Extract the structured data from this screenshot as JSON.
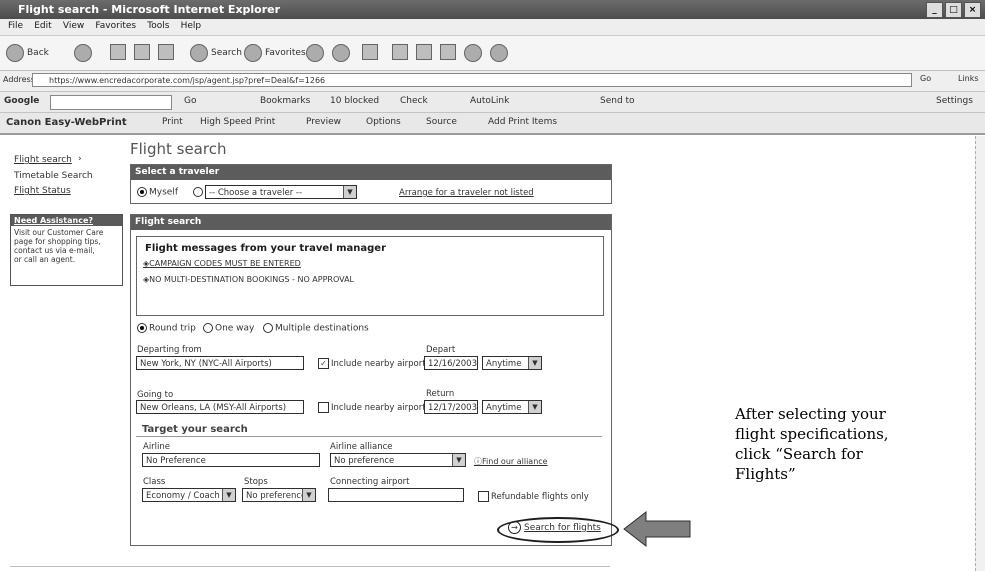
{
  "window": {
    "title": "Flight search - Microsoft Internet Explorer",
    "buttons": [
      "_",
      "□",
      "×"
    ]
  },
  "menubar": [
    "File",
    "Edit",
    "View",
    "Favorites",
    "Tools",
    "Help"
  ],
  "toolbar": {
    "back_label": "Back",
    "search_label": "Search",
    "favorites_label": "Favorites"
  },
  "address": {
    "label": "Address",
    "url": "https://www.encredacorporate.com/jsp/agent.jsp?pref=Deal&f=1266",
    "go_label": "Go",
    "links_label": "Links"
  },
  "googlebar": {
    "logo": "Google",
    "go": "Go",
    "bookmarks": "Bookmarks",
    "blocked": "10 blocked",
    "check": "Check",
    "autolink": "AutoLink",
    "sendto": "Send to",
    "settings": "Settings"
  },
  "canonbar": {
    "logo": "Canon Easy-WebPrint",
    "print": "Print",
    "high_speed": "High Speed Print",
    "preview": "Preview",
    "options": "Options",
    "source": "Source",
    "add_items": "Add Print Items"
  },
  "leftnav": {
    "flight_search": "Flight search",
    "timetable": "Timetable Search",
    "flight_status": "Flight Status",
    "help_title": "Need Assistance?",
    "help_text_1": "Visit our Customer Care",
    "help_text_2": "page for shopping tips,",
    "help_text_3": "contact us via e-mail,",
    "help_text_4": "or call an agent."
  },
  "page_title": "Flight search",
  "traveler": {
    "header": "Select a traveler",
    "myself": "Myself",
    "choose": "-- Choose a traveler --",
    "arrange": "Arrange for a traveler not listed"
  },
  "flight": {
    "header": "Flight search",
    "messages_title": "Flight messages from your travel manager",
    "msg1": "CAMPAIGN CODES MUST BE ENTERED",
    "msg2": "NO MULTI-DESTINATION BOOKINGS - NO APPROVAL",
    "trip_round": "Round trip",
    "trip_oneway": "One way",
    "trip_multi": "Multiple destinations",
    "departing_label": "Departing from",
    "departing_value": "New York, NY (NYC-All Airports)",
    "include_nearby": "Include nearby airports",
    "depart_label": "Depart",
    "depart_date": "12/16/2003",
    "depart_time": "Anytime",
    "going_label": "Going to",
    "going_value": "New Orleans, LA (MSY-All Airports)",
    "return_label": "Return",
    "return_date": "12/17/2003",
    "return_time": "Anytime",
    "target_title": "Target your search",
    "airline_label": "Airline",
    "airline_value": "No Preference",
    "alliance_label": "Airline alliance",
    "alliance_value": "No preference",
    "find_alliance": "Find our alliance",
    "class_label": "Class",
    "class_value": "Economy / Coach",
    "stops_label": "Stops",
    "stops_value": "No preference",
    "connecting_label": "Connecting airport",
    "refundable": "Refundable flights only",
    "search_button": "Search for flights"
  },
  "annotation": "After selecting your flight specifications, click “Search for Flights”"
}
